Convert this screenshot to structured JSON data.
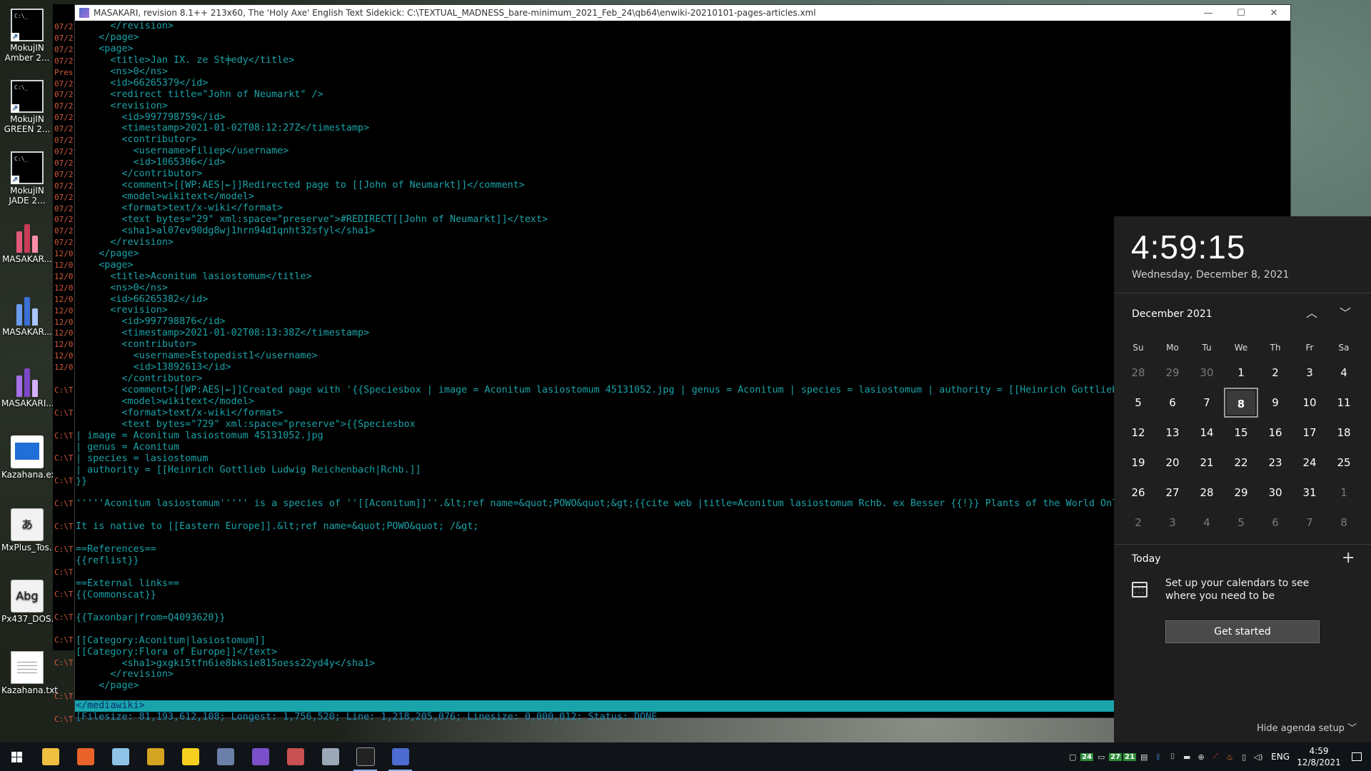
{
  "desktop": {
    "icons": [
      {
        "label": "MokujIN\nAmber 2...",
        "type": "cmd"
      },
      {
        "label": "MokujIN\nGREEN 2...",
        "type": "cmd"
      },
      {
        "label": "MokujIN\nJADE 2...",
        "type": "cmd"
      },
      {
        "label": "MASAKAR...",
        "type": "bars-red"
      },
      {
        "label": "MASAKAR...",
        "type": "bars-blue"
      },
      {
        "label": "MASAKARI...",
        "type": "bars-purple"
      },
      {
        "label": "Kazahana.exe",
        "type": "kazahana"
      },
      {
        "label": "MxPlus_Tos...",
        "type": "font-a"
      },
      {
        "label": "Px437_DOS...",
        "type": "font-abg"
      },
      {
        "label": "Kazahana.txt",
        "type": "text"
      }
    ],
    "icon_glyphs": {
      "font_a": "あ",
      "font_abg": "Abg"
    }
  },
  "back_console": {
    "lines": [
      "07/2",
      "07/2",
      "07/2",
      "07/2",
      "Pres",
      "07/2",
      "07/2",
      "07/2",
      "07/2",
      "07/2",
      "07/2",
      "07/2",
      "07/2",
      "07/2",
      "07/2",
      "07/2",
      "07/2",
      "07/2",
      "07/2",
      "07/2",
      "12/0",
      "12/0",
      "12/0",
      "12/0",
      "12/0",
      "12/0",
      "12/0",
      "12/0",
      "12/0",
      "12/0",
      "12/0",
      "",
      "C:\\T",
      "",
      "C:\\T",
      "",
      "C:\\T",
      "",
      "C:\\T",
      "",
      "C:\\T",
      "",
      "C:\\T",
      "",
      "C:\\T",
      "",
      "C:\\T",
      "",
      "C:\\T",
      "",
      "C:\\T",
      "",
      "C:\\T",
      "",
      "C:\\T",
      "",
      "C:\\T",
      "",
      "",
      "C:\\T",
      "",
      "C:\\T"
    ]
  },
  "window": {
    "title": "MASAKARI, revision 8.1++ 213x60, The 'Holy Axe' English Text Sidekick: C:\\TEXTUAL_MADNESS_bare-minimum_2021_Feb_24\\qb64\\enwiki-20210101-pages-articles.xml",
    "minimize": "—",
    "maximize": "☐",
    "close": "✕"
  },
  "terminal": {
    "lines": [
      "      </revision>",
      "    </page>",
      "    <page>",
      "      <title>Jan IX. ze St╪edy</title>",
      "      <ns>0</ns>",
      "      <id>66265379</id>",
      "      <redirect title=\"John of Neumarkt\" />",
      "      <revision>",
      "        <id>997798759</id>",
      "        <timestamp>2021-01-02T08:12:27Z</timestamp>",
      "        <contributor>",
      "          <username>Filiep</username>",
      "          <id>1065306</id>",
      "        </contributor>",
      "        <comment>[[WP:AES|←]]Redirected page to [[John of Neumarkt]]</comment>",
      "        <model>wikitext</model>",
      "        <format>text/x-wiki</format>",
      "        <text bytes=\"29\" xml:space=\"preserve\">#REDIRECT[[John of Neumarkt]]</text>",
      "        <sha1>al07ev90dg8wj1hrn94d1qnht32sfyl</sha1>",
      "      </revision>",
      "    </page>",
      "    <page>",
      "      <title>Aconitum lasiostomum</title>",
      "      <ns>0</ns>",
      "      <id>66265382</id>",
      "      <revision>",
      "        <id>997798876</id>",
      "        <timestamp>2021-01-02T08:13:38Z</timestamp>",
      "        <contributor>",
      "          <username>Estopedist1</username>",
      "          <id>13892613</id>",
      "        </contributor>",
      "        <comment>[[WP:AES|←]]Created page with '{{Speciesbox | image = Aconitum lasiostomum 45131052.jpg | genus = Aconitum | species = lasiostomum | authority = [[Heinrich Gottlieb Ludw",
      "        <model>wikitext</model>",
      "        <format>text/x-wiki</format>",
      "        <text bytes=\"729\" xml:space=\"preserve\">{{Speciesbox",
      "| image = Aconitum lasiostomum 45131052.jpg",
      "| genus = Aconitum",
      "| species = lasiostomum",
      "| authority = [[Heinrich Gottlieb Ludwig Reichenbach|Rchb.]]",
      "}}",
      "",
      "'''''Aconitum lasiostomum''''' is a species of ''[[Aconitum]]''.&lt;ref name=&quot;POWO&quot;&gt;{{cite web |title=Aconitum lasiostomum Rchb. ex Besser {{!}} Plants of the World Online |url=ht",
      "",
      "It is native to [[Eastern Europe]].&lt;ref name=&quot;POWO&quot; /&gt;",
      "",
      "==References==",
      "{{reflist}}",
      "",
      "==External links==",
      "{{Commonscat}}",
      "",
      "{{Taxonbar|from=Q4093620}}",
      "",
      "[[Category:Aconitum|lasiostomum]]",
      "[[Category:Flora of Europe]]</text>",
      "        <sha1>gxgki5tfn6ie8bksie815oess22yd4y</sha1>",
      "      </revision>",
      "    </page>"
    ],
    "selected_line": "</mediawiki>",
    "status_line": "[Filesize: 81,193,612,108; Longest: 1,756,520; Line: 1,218,205,076; Linesize: 0,000,012; Status: DONE"
  },
  "flyout": {
    "time": "4:59:15",
    "date": "Wednesday, December 8, 2021",
    "month_label": "December 2021",
    "prev_label": "︿",
    "next_label": "﹀",
    "weekdays": [
      "Su",
      "Mo",
      "Tu",
      "We",
      "Th",
      "Fr",
      "Sa"
    ],
    "weeks": [
      [
        {
          "d": "28",
          "m": "prev"
        },
        {
          "d": "29",
          "m": "prev"
        },
        {
          "d": "30",
          "m": "prev"
        },
        {
          "d": "1"
        },
        {
          "d": "2"
        },
        {
          "d": "3"
        },
        {
          "d": "4"
        }
      ],
      [
        {
          "d": "5"
        },
        {
          "d": "6"
        },
        {
          "d": "7"
        },
        {
          "d": "8",
          "today": true
        },
        {
          "d": "9"
        },
        {
          "d": "10"
        },
        {
          "d": "11"
        }
      ],
      [
        {
          "d": "12"
        },
        {
          "d": "13"
        },
        {
          "d": "14"
        },
        {
          "d": "15"
        },
        {
          "d": "16"
        },
        {
          "d": "17"
        },
        {
          "d": "18"
        }
      ],
      [
        {
          "d": "19"
        },
        {
          "d": "20"
        },
        {
          "d": "21"
        },
        {
          "d": "22"
        },
        {
          "d": "23"
        },
        {
          "d": "24"
        },
        {
          "d": "25"
        }
      ],
      [
        {
          "d": "26"
        },
        {
          "d": "27"
        },
        {
          "d": "28"
        },
        {
          "d": "29"
        },
        {
          "d": "30"
        },
        {
          "d": "31"
        },
        {
          "d": "1",
          "m": "next"
        }
      ],
      [
        {
          "d": "2",
          "m": "next"
        },
        {
          "d": "3",
          "m": "next"
        },
        {
          "d": "4",
          "m": "next"
        },
        {
          "d": "5",
          "m": "next"
        },
        {
          "d": "6",
          "m": "next"
        },
        {
          "d": "7",
          "m": "next"
        },
        {
          "d": "8",
          "m": "next"
        }
      ]
    ],
    "today_label": "Today",
    "add_label": "+",
    "agenda_text": "Set up your calendars to see where you need to be",
    "get_started": "Get started",
    "hide_agenda": "Hide agenda setup  ﹀"
  },
  "taskbar": {
    "apps": [
      {
        "name": "file-explorer",
        "color": "#f0c040"
      },
      {
        "name": "firefox",
        "color": "#e8632a"
      },
      {
        "name": "notepad",
        "color": "#8fc3e8"
      },
      {
        "name": "app-yellow",
        "color": "#d4a520"
      },
      {
        "name": "sticky-notes",
        "color": "#f5d020"
      },
      {
        "name": "calculator",
        "color": "#6b7fa8"
      },
      {
        "name": "app-purple",
        "color": "#7a4fc8"
      },
      {
        "name": "image-viewer",
        "color": "#c85050"
      },
      {
        "name": "network-tool",
        "color": "#9aa8b8"
      },
      {
        "name": "command-prompt",
        "color": "#222222",
        "active": true
      },
      {
        "name": "masakari",
        "color": "#4d6bd1",
        "active": true
      }
    ],
    "tray": {
      "badges": [
        "24",
        "27",
        "21"
      ],
      "language": "ENG",
      "time": "4:59",
      "date": "12/8/2021"
    }
  }
}
